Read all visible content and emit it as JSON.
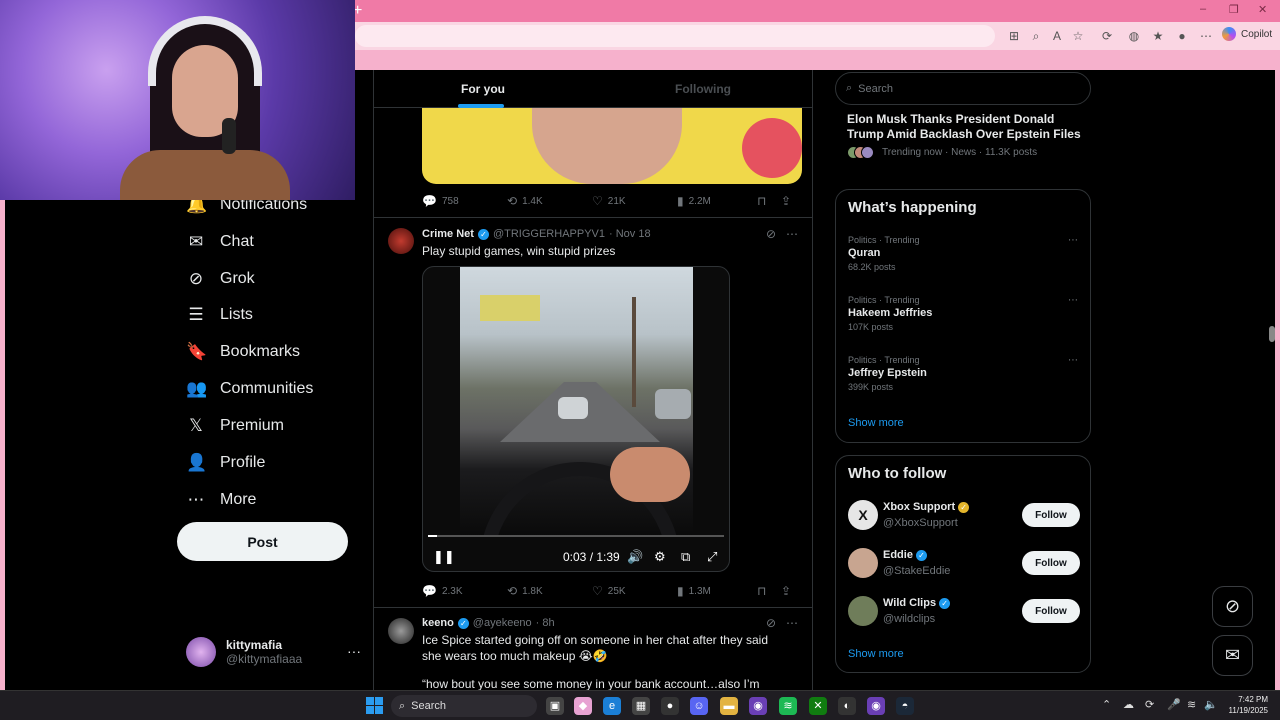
{
  "browser": {
    "new_tab": "+",
    "copilot_label": "Copilot",
    "window_controls": [
      "–",
      "❐",
      "✕"
    ]
  },
  "nav": {
    "items": [
      {
        "label": "Notifications",
        "icon": "bell-icon",
        "glyph": "🔔"
      },
      {
        "label": "Chat",
        "icon": "mail-icon",
        "glyph": "✉"
      },
      {
        "label": "Grok",
        "icon": "grok-icon",
        "glyph": "⊘"
      },
      {
        "label": "Lists",
        "icon": "list-icon",
        "glyph": "☰"
      },
      {
        "label": "Bookmarks",
        "icon": "bookmark-icon",
        "glyph": "🔖"
      },
      {
        "label": "Communities",
        "icon": "communities-icon",
        "glyph": "👥"
      },
      {
        "label": "Premium",
        "icon": "x-logo-icon",
        "glyph": "𝕏"
      },
      {
        "label": "Profile",
        "icon": "profile-icon",
        "glyph": "👤"
      },
      {
        "label": "More",
        "icon": "more-circle-icon",
        "glyph": "⋯"
      }
    ],
    "post_label": "Post",
    "account": {
      "name": "kittymafia",
      "handle": "@kittymafiaaa",
      "menu": "···"
    }
  },
  "feed": {
    "tabs": {
      "active": "For you",
      "inactive": "Following"
    },
    "first_post_stats": {
      "replies": "758",
      "reposts": "1.4K",
      "likes": "21K",
      "views": "2.2M"
    },
    "tweet1": {
      "name": "Crime Net",
      "handle": "@TRIGGERHAPPYV1",
      "date": "· Nov 18",
      "text": "Play stupid games, win stupid prizes",
      "video_time": "0:03 / 1:39",
      "video_progress": 0.03,
      "stats": {
        "replies": "2.3K",
        "reposts": "1.8K",
        "likes": "25K",
        "views": "1.3M"
      }
    },
    "tweet2": {
      "name": "keeno",
      "handle": "@ayekeeno",
      "date": "· 8h",
      "text": "Ice Spice started going off on someone in her chat after they said she wears too much makeup 😭🤣",
      "text2": "“how bout you see some money in your bank account…also I’m barely"
    }
  },
  "right": {
    "search_placeholder": "Search",
    "top_trend": {
      "title": "Elon Musk Thanks President Donald Trump Amid Backlash Over Epstein Files ...",
      "meta": "Trending now · News · 11.3K posts"
    },
    "happening": {
      "title": "What’s happening",
      "trends": [
        {
          "category": "Politics · Trending",
          "name": "Quran",
          "posts": "68.2K posts"
        },
        {
          "category": "Politics · Trending",
          "name": "Hakeem Jeffries",
          "posts": "107K posts"
        },
        {
          "category": "Politics · Trending",
          "name": "Jeffrey Epstein",
          "posts": "399K posts"
        }
      ],
      "show_more": "Show more"
    },
    "who_to_follow": {
      "title": "Who to follow",
      "accounts": [
        {
          "name": "Xbox Support",
          "handle": "@XboxSupport",
          "avatar_color": "#e6e6e6"
        },
        {
          "name": "Eddie",
          "handle": "@StakeEddie",
          "avatar_color": "#c8a590"
        },
        {
          "name": "Wild Clips",
          "handle": "@wildclips",
          "avatar_color": "#6f7d5a"
        }
      ],
      "follow_label": "Follow",
      "show_more": "Show more"
    }
  },
  "taskbar": {
    "search_label": "Search",
    "time": "7:42 PM",
    "date": "11/19/2025"
  },
  "colors": {
    "accent": "#1d9bf0",
    "browser_pink": "#f07aa6",
    "background": "#000000"
  }
}
